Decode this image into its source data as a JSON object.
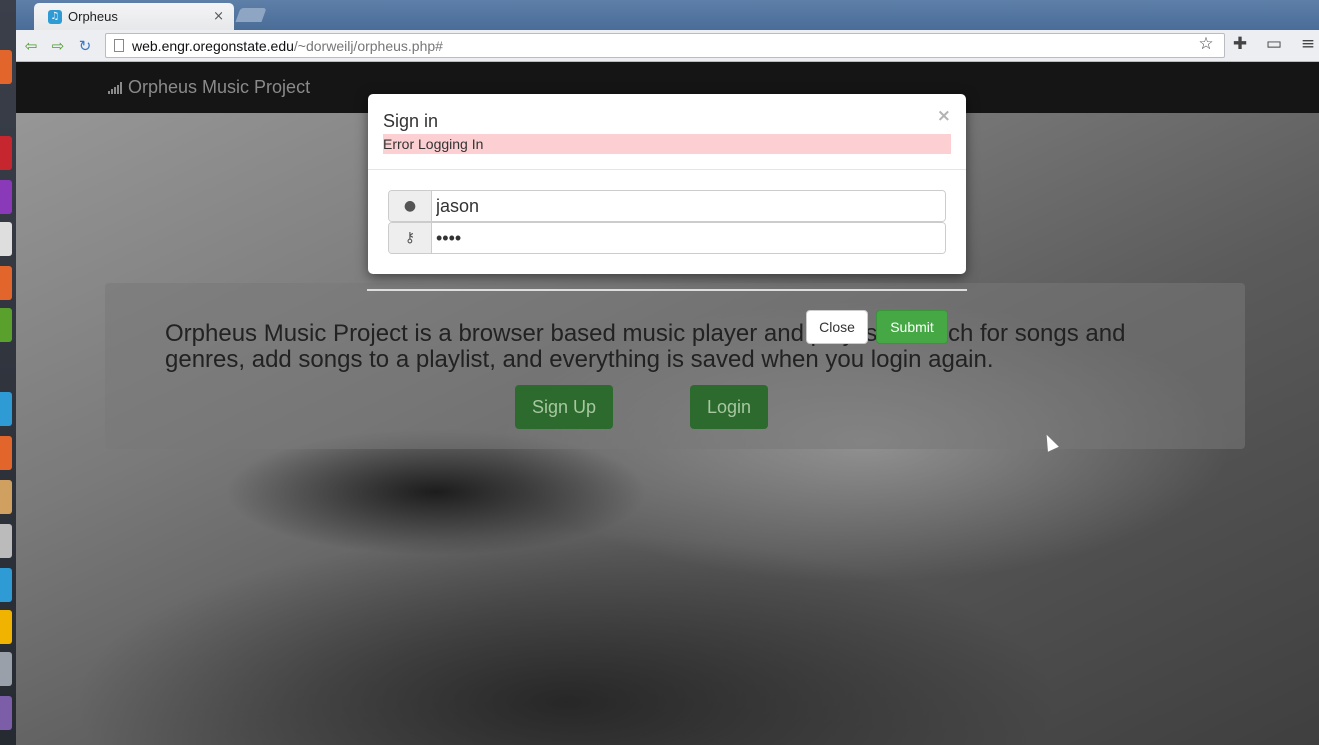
{
  "browser": {
    "tab_title": "Orpheus",
    "tab_close": "×",
    "url_host": "web.engr.oregonstate.edu",
    "url_path": "/~dorweilj/orpheus.php#",
    "icons": [
      "back-icon",
      "forward-icon",
      "reload-icon",
      "star-icon",
      "extension-icon",
      "cast-icon",
      "menu-icon"
    ]
  },
  "navbar": {
    "brand": "Orpheus Music Project"
  },
  "jumbotron": {
    "description": "Orpheus Music Project is a browser based music player and playlist. Search for songs and genres, add songs to a playlist, and everything is saved when you login again.",
    "signup_label": "Sign Up",
    "login_label": "Login"
  },
  "modal": {
    "title": "Sign in",
    "close_x": "×",
    "error": "Error Logging In",
    "username_value": "jason",
    "password_value": "••••",
    "close_label": "Close",
    "submit_label": "Submit"
  },
  "colors": {
    "error_bg": "#fccfd3",
    "submit_bg": "#45a845",
    "navbar_bg": "#151515",
    "jumbo_btn_bg": "#2d6a2d"
  }
}
